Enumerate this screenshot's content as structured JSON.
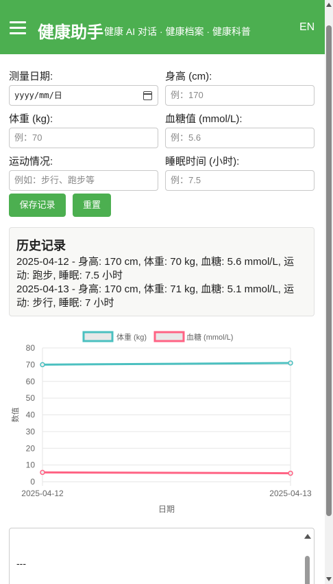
{
  "header": {
    "title": "健康助手",
    "subtitle": "健康 AI 对话 · 健康档案 · 健康科普",
    "lang": "EN",
    "menu_icon": "hamburger-menu-icon"
  },
  "form": {
    "date": {
      "label": "测量日期:",
      "value": "yyyy/mm/日"
    },
    "height": {
      "label": "身高 (cm):",
      "placeholder": "例：170"
    },
    "weight": {
      "label": "体重 (kg):",
      "placeholder": "例：70"
    },
    "glucose": {
      "label": "血糖值 (mmol/L):",
      "placeholder": "例：5.6"
    },
    "exercise": {
      "label": "运动情况:",
      "placeholder": "例如：步行、跑步等"
    },
    "sleep": {
      "label": "睡眠时间 (小时):",
      "placeholder": "例：7.5"
    },
    "save_label": "保存记录",
    "reset_label": "重置"
  },
  "history": {
    "title": "历史记录",
    "records": [
      "2025-04-12 - 身高: 170 cm, 体重: 70 kg, 血糖: 5.6 mmol/L, 运动: 跑步, 睡眠: 7.5 小时",
      "2025-04-13 - 身高: 170 cm, 体重: 71 kg, 血糖: 5.1 mmol/L, 运动: 步行, 睡眠: 7 小时"
    ]
  },
  "chart_data": {
    "type": "line",
    "categories": [
      "2025-04-12",
      "2025-04-13"
    ],
    "series": [
      {
        "name": "体重 (kg)",
        "values": [
          70,
          71
        ],
        "color": "#4bc0c0"
      },
      {
        "name": "血糖 (mmol/L)",
        "values": [
          5.6,
          5.1
        ],
        "color": "#ff6384"
      }
    ],
    "xlabel": "日期",
    "ylabel": "数值",
    "ylim": [
      0,
      80
    ],
    "yticks": [
      0,
      10,
      20,
      30,
      40,
      50,
      60,
      70,
      80
    ],
    "grid": true,
    "legend": "top"
  },
  "bottom": {
    "cut_text": "· · · · · ·",
    "dash": "---"
  }
}
